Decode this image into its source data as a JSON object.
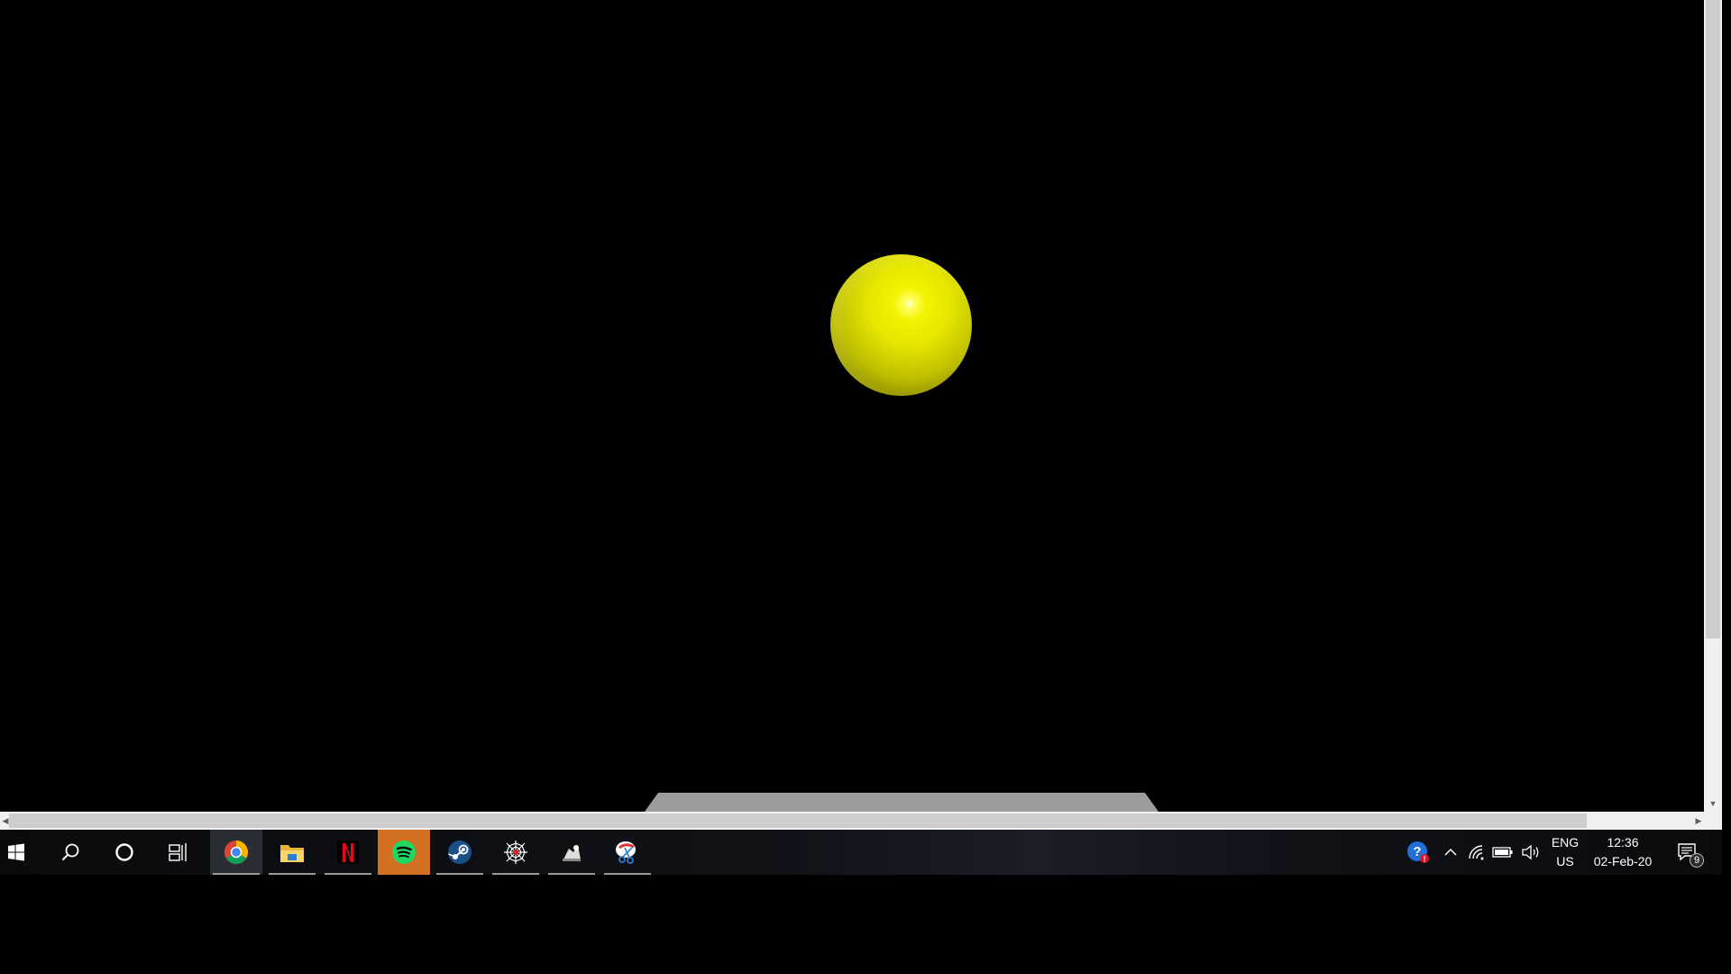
{
  "scene": {
    "ball_color": "#e6e600",
    "background_color": "#000000",
    "floor_color": "#9c9c9c"
  },
  "taskbar": {
    "start_icon": "windows-logo-icon",
    "search_icon": "search-icon",
    "cortana_icon": "cortana-circle-icon",
    "taskview_icon": "task-view-icon",
    "apps": [
      {
        "name": "Google Chrome",
        "icon": "chrome-icon",
        "active": true
      },
      {
        "name": "File Explorer",
        "icon": "file-explorer-icon",
        "active": false
      },
      {
        "name": "Netflix",
        "icon": "netflix-icon",
        "active": false
      },
      {
        "name": "Spotify",
        "icon": "spotify-icon",
        "active": false
      },
      {
        "name": "Steam",
        "icon": "steam-icon",
        "active": false
      },
      {
        "name": "Web",
        "icon": "spiderweb-icon",
        "active": false
      },
      {
        "name": "Game",
        "icon": "game-icon",
        "active": false
      },
      {
        "name": "Snipping Tool",
        "icon": "snipping-tool-icon",
        "active": false
      }
    ],
    "tray": {
      "help_icon": "help-icon",
      "chevron_icon": "chevron-up-icon",
      "wifi_icon": "wifi-icon",
      "battery_icon": "battery-icon",
      "volume_icon": "volume-icon",
      "lang_top": "ENG",
      "lang_bottom": "US",
      "time": "12:36",
      "date": "02-Feb-20",
      "notification_count": "9",
      "notification_icon": "action-center-icon"
    }
  }
}
